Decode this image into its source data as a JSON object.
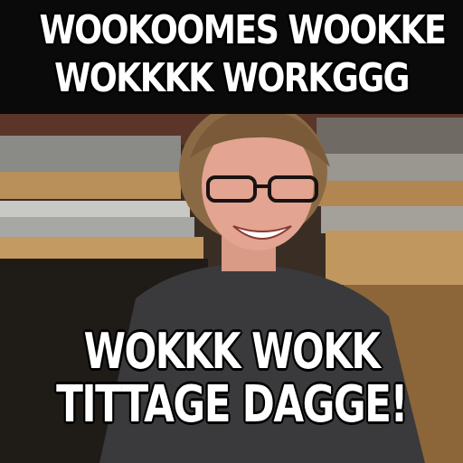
{
  "meme": {
    "top_line_1": "WOOKOOMES WOOKKE",
    "top_line_2": "WOKKKK WORKGGG",
    "bottom_line_1": "WOKKK WOKK",
    "bottom_line_2": "TITTAGE DAGGE!"
  },
  "photo": {
    "subject": "smiling-person-with-glasses",
    "setting": "auditorium-seating"
  },
  "colors": {
    "caption_text": "#ffffff",
    "caption_outline": "#000000",
    "top_bar": "#0a0a0a"
  }
}
